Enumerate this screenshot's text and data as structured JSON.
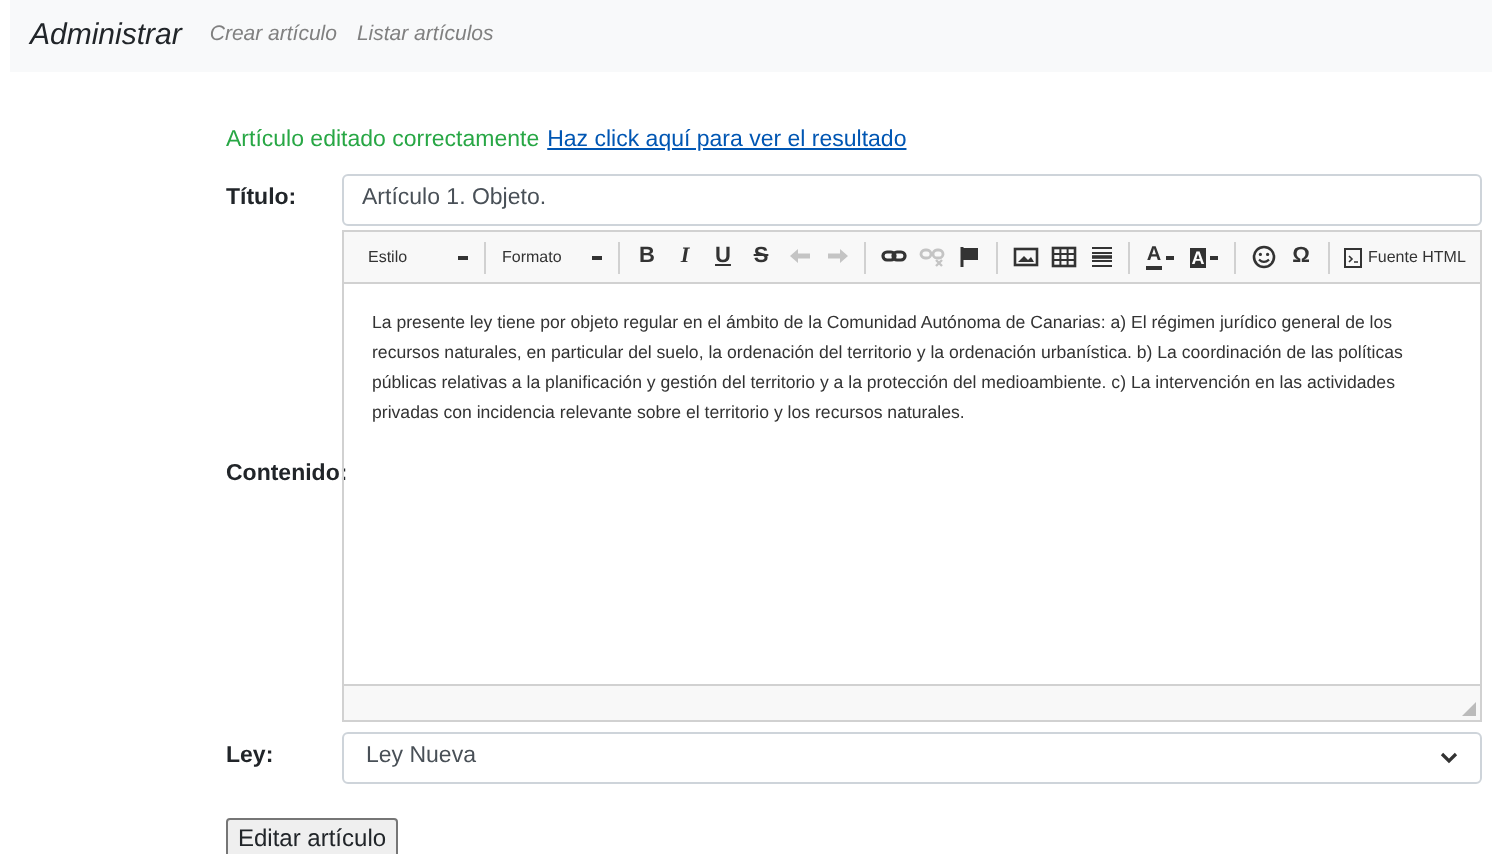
{
  "navbar": {
    "brand": "Administrar",
    "links": [
      {
        "label": "Crear artículo"
      },
      {
        "label": "Listar artículos"
      }
    ]
  },
  "alert": {
    "message": "Artículo editado correctamente",
    "link": "Haz click aquí para ver el resultado"
  },
  "form": {
    "title_label": "Título:",
    "title_value": "Artículo 1. Objeto.",
    "content_label": "Contenido:",
    "editor": {
      "toolbar": [
        [
          {
            "kind": "dropdown",
            "label": "Estilo"
          }
        ],
        [
          {
            "kind": "dropdown",
            "label": "Formato"
          }
        ],
        [
          {
            "kind": "glyph",
            "label": "B"
          },
          {
            "kind": "glyph",
            "label": "I"
          },
          {
            "kind": "glyph",
            "label": "U"
          },
          {
            "kind": "glyph",
            "label": "S"
          },
          {
            "kind": "icon",
            "disabled": true
          },
          {
            "kind": "icon",
            "disabled": true
          }
        ],
        [
          {
            "kind": "icon",
            "disabled": false
          },
          {
            "kind": "icon",
            "disabled": true
          },
          {
            "kind": "icon",
            "disabled": false
          }
        ],
        [
          {
            "kind": "icon",
            "disabled": false
          },
          {
            "kind": "icon",
            "disabled": false
          },
          {
            "kind": "icon",
            "disabled": false
          }
        ],
        [
          {
            "kind": "color",
            "label": "A"
          },
          {
            "kind": "color",
            "label": "A"
          }
        ],
        [
          {
            "kind": "icon",
            "disabled": false
          },
          {
            "kind": "glyph",
            "label": "Ω"
          }
        ],
        [
          {
            "kind": "source",
            "label": "Fuente HTML"
          }
        ]
      ],
      "content": "La presente ley tiene por objeto regular en el ámbito de la Comunidad Autónoma de Canarias: a) El régimen jurídico general de los recursos naturales, en particular del suelo, la ordenación del territorio y la ordenación urbanística. b) La coordinación de las políticas públicas relativas a la planificación y gestión del territorio y a la protección del medioambiente. c) La intervención en las actividades privadas con incidencia relevante sobre el territorio y los recursos naturales."
    },
    "law_label": "Ley:",
    "law_value": "Ley Nueva",
    "submit": "Editar artículo"
  }
}
